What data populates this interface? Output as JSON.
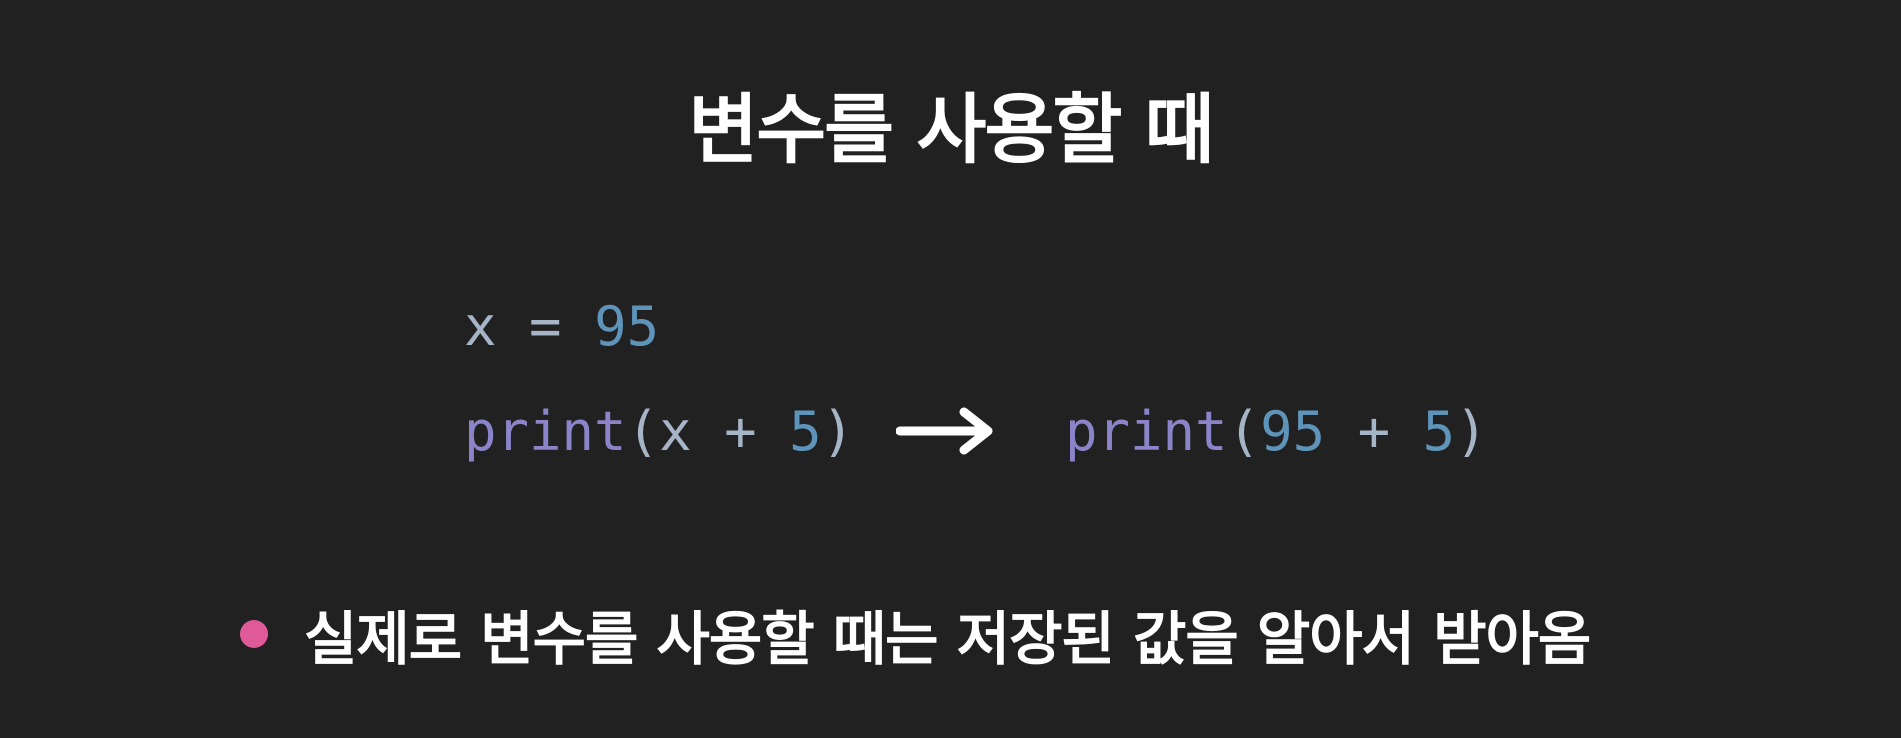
{
  "title": "변수를 사용할 때",
  "code": {
    "line1": {
      "ident": "x",
      "op": " = ",
      "num": "95"
    },
    "line2": {
      "fn": "print",
      "open": "(",
      "ident": "x",
      "op": " + ",
      "num": "5",
      "close": ")"
    },
    "line3": {
      "fn": "print",
      "open": "(",
      "num1": "95",
      "op": " + ",
      "num2": "5",
      "close": ")"
    }
  },
  "arrow_icon": "right-arrow-icon",
  "bullet": {
    "text": "실제로 변수를 사용할 때는 저장된 값을 알아서 받아옴",
    "dot_color": "#e05a9a"
  },
  "colors": {
    "background": "#212121",
    "identifier": "#a6b4c8",
    "number": "#5e94ba",
    "function": "#8c84c8"
  }
}
